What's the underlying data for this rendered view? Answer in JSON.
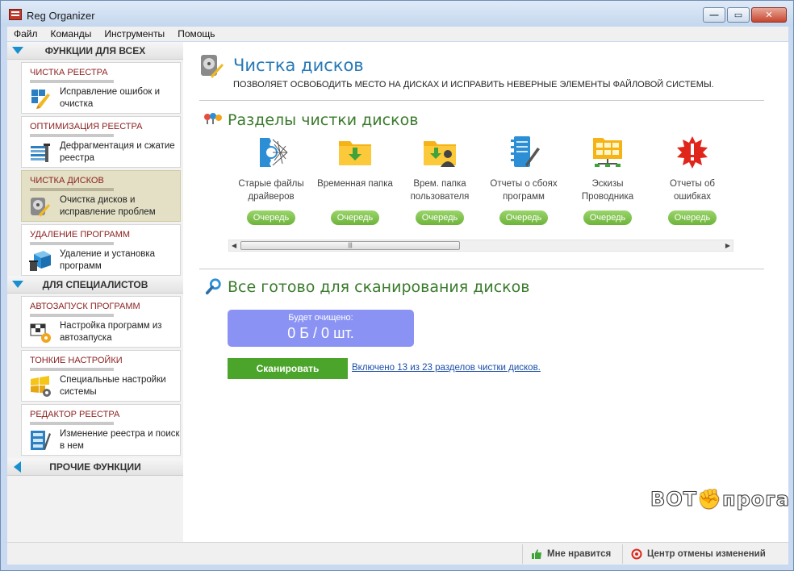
{
  "window": {
    "title": "Reg Organizer"
  },
  "menu": [
    "Файл",
    "Команды",
    "Инструменты",
    "Помощь"
  ],
  "sidebar": {
    "group1": "ФУНКЦИИ ДЛЯ ВСЕХ",
    "group2": "ДЛЯ СПЕЦИАЛИСТОВ",
    "group3": "ПРОЧИЕ ФУНКЦИИ",
    "items": [
      {
        "title": "ЧИСТКА РЕЕСТРА",
        "desc": "Исправление ошибок и очистка",
        "icon": "registry-clean-icon"
      },
      {
        "title": "ОПТИМИЗАЦИЯ РЕЕСТРА",
        "desc": "Дефрагментация и сжатие реестра",
        "icon": "registry-optimize-icon"
      },
      {
        "title": "ЧИСТКА ДИСКОВ",
        "desc": "Очистка дисков и исправление проблем",
        "icon": "disk-clean-icon",
        "active": true
      },
      {
        "title": "УДАЛЕНИЕ ПРОГРАММ",
        "desc": "Удаление и установка программ",
        "icon": "uninstall-icon"
      },
      {
        "title": "АВТОЗАПУСК ПРОГРАММ",
        "desc": "Настройка программ из автозапуска",
        "icon": "autorun-icon"
      },
      {
        "title": "ТОНКИЕ НАСТРОЙКИ",
        "desc": "Специальные настройки системы",
        "icon": "tweaks-icon"
      },
      {
        "title": "РЕДАКТОР РЕЕСТРА",
        "desc": "Изменение реестра и поиск в нем",
        "icon": "registry-editor-icon"
      }
    ]
  },
  "main": {
    "title": "Чистка дисков",
    "subtitle": "ПОЗВОЛЯЕТ ОСВОБОДИТЬ МЕСТО НА ДИСКАХ И ИСПРАВИТЬ НЕВЕРНЫЕ ЭЛЕМЕНТЫ ФАЙЛОВОЙ СИСТЕМЫ.",
    "sections_title": "Разделы чистки дисков",
    "categories": [
      {
        "label": "Старые файлы драйверов",
        "button": "Очередь",
        "icon": "driver-files-icon"
      },
      {
        "label": "Временная папка",
        "button": "Очередь",
        "icon": "temp-folder-icon"
      },
      {
        "label": "Врем. папка пользователя",
        "button": "Очередь",
        "icon": "user-temp-folder-icon"
      },
      {
        "label": "Отчеты о сбоях программ",
        "button": "Очередь",
        "icon": "crash-reports-icon"
      },
      {
        "label": "Эскизы Проводника",
        "button": "Очередь",
        "icon": "thumbnails-icon"
      },
      {
        "label": "Отчеты об ошибках",
        "button": "Очередь",
        "icon": "error-reports-icon"
      }
    ],
    "ready_title": "Все готово для сканирования дисков",
    "summary_label": "Будет очищено:",
    "summary_value": "0 Б / 0 шт.",
    "scan_button": "Сканировать",
    "scan_link": "Включено 13 из 23 разделов чистки дисков."
  },
  "statusbar": {
    "like": "Мне нравится",
    "undo_center": "Центр отмены изменений"
  },
  "watermark": {
    "left": "BOT",
    "right": "прога"
  },
  "colors": {
    "accent": "#2779b8",
    "green": "#4ba52b",
    "summary": "#8a93f3"
  }
}
